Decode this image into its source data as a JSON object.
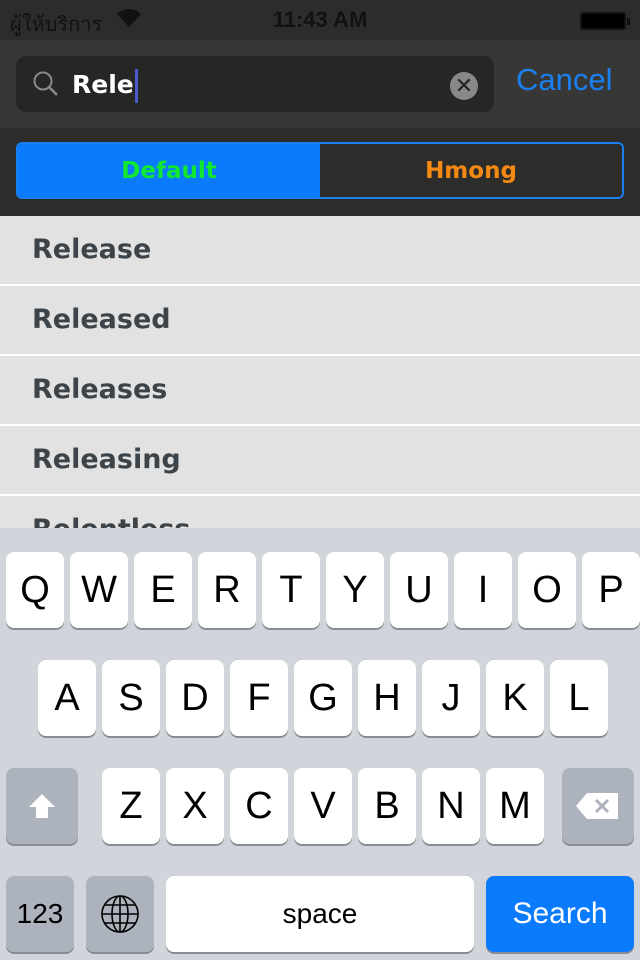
{
  "status": {
    "carrier": "ผู้ให้บริการ",
    "time": "11:43 AM"
  },
  "search": {
    "query": "Rele",
    "cancel": "Cancel"
  },
  "segments": {
    "default": "Default",
    "hmong": "Hmong",
    "selected": "Default"
  },
  "results": [
    "Release",
    "Released",
    "Releases",
    "Releasing",
    "Relentless"
  ],
  "keyboard": {
    "row1": [
      "Q",
      "W",
      "E",
      "R",
      "T",
      "Y",
      "U",
      "I",
      "O",
      "P"
    ],
    "row2": [
      "A",
      "S",
      "D",
      "F",
      "G",
      "H",
      "J",
      "K",
      "L"
    ],
    "row3": [
      "Z",
      "X",
      "C",
      "V",
      "B",
      "N",
      "M"
    ],
    "numbers": "123",
    "space": "space",
    "search": "Search"
  },
  "colors": {
    "accent": "#0a7bfd",
    "default_text": "#12e830",
    "hmong_text": "#f48a13"
  }
}
